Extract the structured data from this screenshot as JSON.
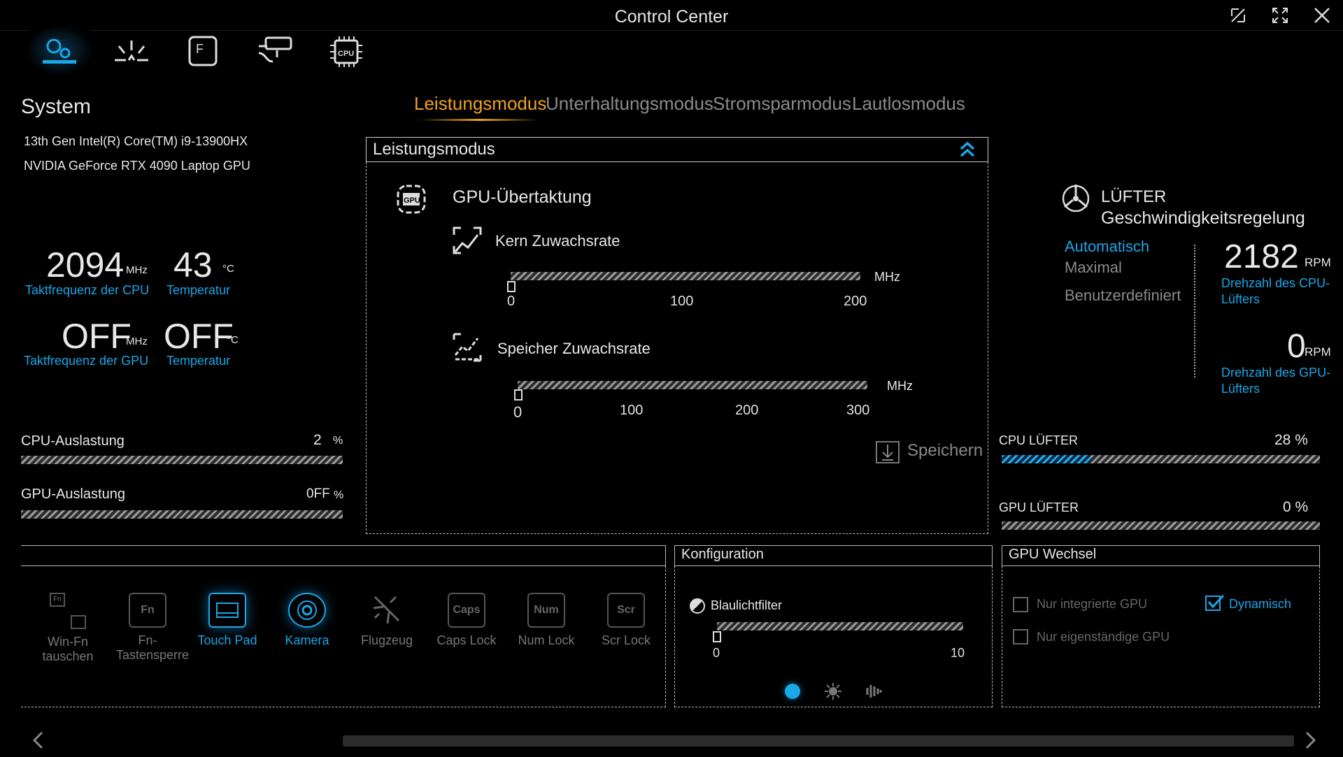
{
  "window": {
    "title": "Control Center"
  },
  "tabs": [
    "Leistungsmodus",
    "Unterhaltungsmodus",
    "Stromsparmodus",
    "Lautlosmodus"
  ],
  "system": {
    "heading": "System",
    "cpu_name": "13th Gen Intel(R) Core(TM) i9-13900HX",
    "gpu_name": "NVIDIA GeForce RTX 4090 Laptop GPU",
    "cpu_freq": "2094",
    "cpu_freq_unit": "MHz",
    "cpu_freq_label": "Taktfrequenz der CPU",
    "cpu_temp": "43",
    "cpu_temp_unit": "°C",
    "cpu_temp_label": "Temperatur",
    "gpu_freq": "OFF",
    "gpu_freq_unit": "MHz",
    "gpu_freq_label": "Taktfrequenz der GPU",
    "gpu_temp": "OFF",
    "gpu_temp_unit": "°C",
    "gpu_temp_label": "Temperatur",
    "cpu_load_label": "CPU-Auslastung",
    "cpu_load": "2",
    "cpu_load_unit": "%",
    "gpu_load_label": "GPU-Auslastung",
    "gpu_load": "0FF",
    "gpu_load_unit": "%"
  },
  "perf": {
    "panel_title": "Leistungsmodus",
    "gpu_oc": "GPU-Übertaktung",
    "core_label": "Kern Zuwachsrate",
    "core_unit": "MHz",
    "core_ticks": [
      "0",
      "100",
      "200"
    ],
    "core_value": 0,
    "mem_label": "Speicher Zuwachsrate",
    "mem_unit": "MHz",
    "mem_ticks": [
      "0",
      "100",
      "200",
      "300"
    ],
    "mem_value": 0,
    "save": "Speichern"
  },
  "fan": {
    "title1": "LÜFTER",
    "title2": "Geschwindigkeitsregelung",
    "modes": [
      "Automatisch",
      "Maximal",
      "Benutzerdefiniert"
    ],
    "cpu_rpm": "2182",
    "cpu_rpm_unit": "RPM",
    "cpu_rpm_label": "Drehzahl des CPU-Lüfters",
    "gpu_rpm": "0",
    "gpu_rpm_unit": "RPM",
    "gpu_rpm_label": "Drehzahl des GPU-Lüfters",
    "cpu_fan_label": "CPU LÜFTER",
    "cpu_fan_pct": "28 %",
    "cpu_fan_fraction": 0.28,
    "gpu_fan_label": "GPU LÜFTER",
    "gpu_fan_pct": "0 %"
  },
  "keys": [
    {
      "glyph": "Fn",
      "label": "Win-Fn tauschen"
    },
    {
      "glyph": "Fn",
      "label": "Fn-Tastensperre"
    },
    {
      "glyph": "",
      "label": "Touch Pad"
    },
    {
      "glyph": "",
      "label": "Kamera"
    },
    {
      "glyph": "",
      "label": "Flugzeug"
    },
    {
      "glyph": "Caps",
      "label": "Caps Lock"
    },
    {
      "glyph": "Num",
      "label": "Num Lock"
    },
    {
      "glyph": "Scr",
      "label": "Scr Lock"
    }
  ],
  "config": {
    "title": "Konfiguration",
    "bluelight": "Blaulichtfilter",
    "ticks": [
      "0",
      "10"
    ],
    "value": 0
  },
  "gpu_switch": {
    "title": "GPU Wechsel",
    "opt_integrated": "Nur integrierte GPU",
    "opt_dynamic": "Dynamisch",
    "opt_discrete": "Nur eigenständige GPU"
  },
  "colors": {
    "accent": "#1aa7e8",
    "active_tab": "#f0a020"
  }
}
